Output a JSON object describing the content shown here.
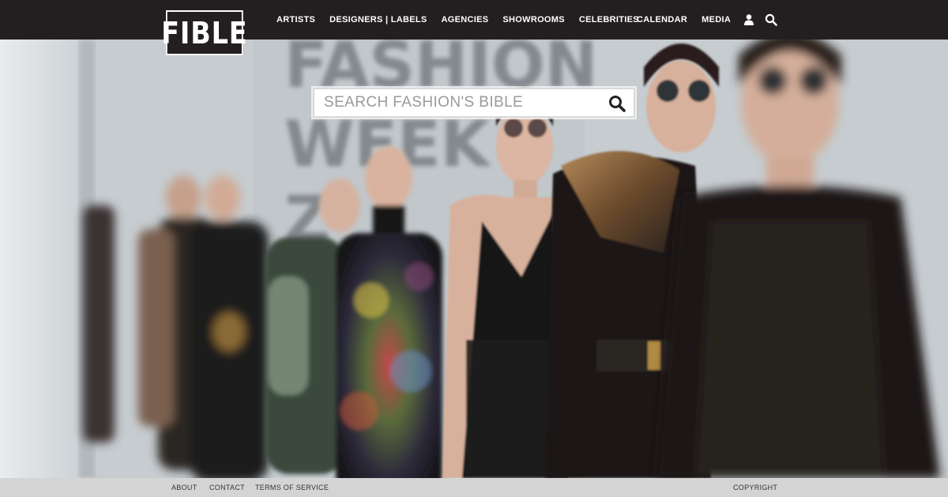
{
  "brand": {
    "logo_text": "FIBLE"
  },
  "nav": {
    "left": [
      "ARTISTS",
      "DESIGNERS | LABELS",
      "AGENCIES",
      "SHOWROOMS",
      "CELEBRITIES"
    ],
    "right": [
      "CALENDAR",
      "MEDIA"
    ],
    "icons": [
      "user-icon",
      "search-icon"
    ]
  },
  "search": {
    "placeholder": "SEARCH FASHION'S BIBLE",
    "value": ""
  },
  "footer": {
    "about": "ABOUT",
    "contact": "CONTACT",
    "terms": "TERMS OF SERVICE",
    "copyright": "COPYRIGHT"
  },
  "colors": {
    "header_bg": "#231f20",
    "footer_bg": "#d4d4d4",
    "text_light": "#ffffff"
  }
}
